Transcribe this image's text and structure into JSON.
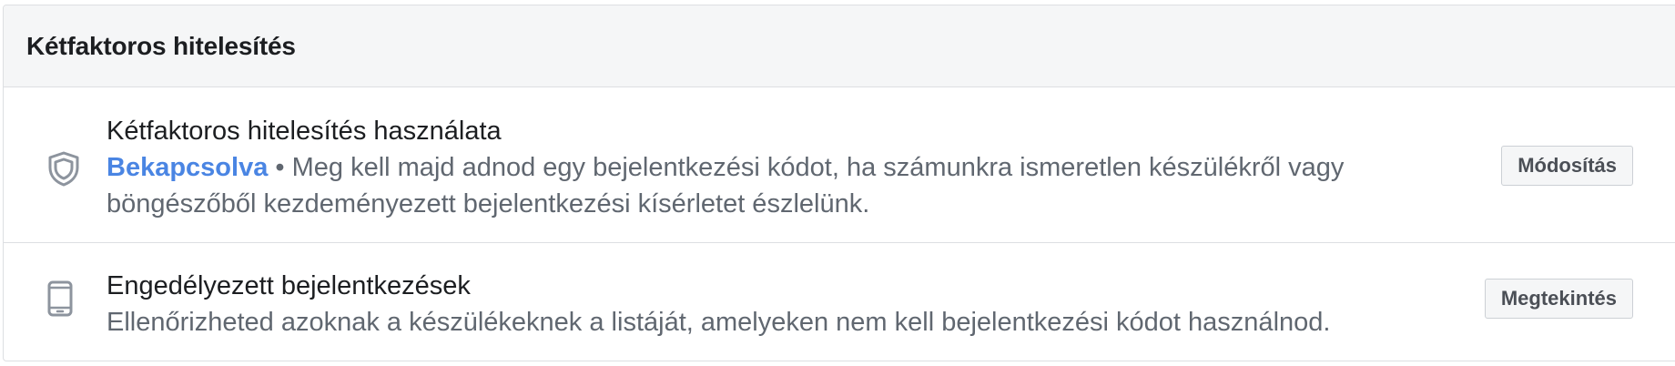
{
  "section": {
    "title": "Kétfaktoros hitelesítés"
  },
  "rows": [
    {
      "icon": "shield-icon",
      "title": "Kétfaktoros hitelesítés használata",
      "status": "Bekapcsolva",
      "separator": " • ",
      "description": "Meg kell majd adnod egy bejelentkezési kódot, ha számunkra ismeretlen készülékről vagy böngészőből kezdeményezett bejelentkezési kísérletet észlelünk.",
      "button_label": "Módosítás"
    },
    {
      "icon": "mobile-device-icon",
      "title": "Engedélyezett bejelentkezések",
      "description": "Ellenőrizheted azoknak a készülékeknek a listáját, amelyeken nem kell bejelentkezési kódot használnod.",
      "button_label": "Megtekintés"
    }
  ],
  "colors": {
    "status_accent": "#4a85e3",
    "header_background": "#f5f6f7",
    "border": "#dddfe2"
  }
}
